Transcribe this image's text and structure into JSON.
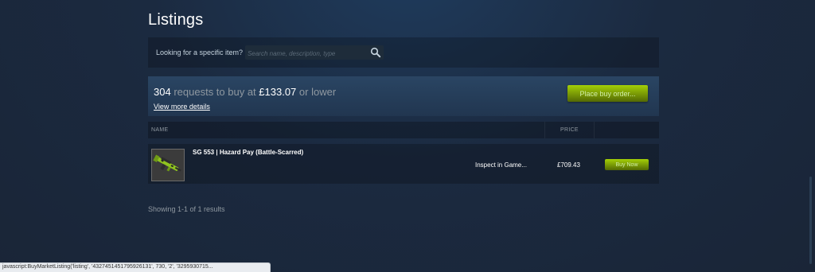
{
  "page": {
    "title": "Listings"
  },
  "search": {
    "label": "Looking for a specific item?",
    "placeholder": "Search name, description, type",
    "value": ""
  },
  "buy_order": {
    "count": "304",
    "text_requests": "requests to buy at",
    "price": "£133.07",
    "text_suffix": "or lower",
    "details_link": "View more details",
    "button_label": "Place buy order..."
  },
  "table": {
    "columns": [
      "NAME",
      "PRICE"
    ],
    "rows": [
      {
        "name": "SG 553 | Hazard Pay (Battle-Scarred)",
        "inspect_label": "Inspect in Game...",
        "price": "£709.43",
        "buy_label": "Buy Now"
      }
    ]
  },
  "results_text": "Showing 1-1 of 1 results",
  "status_bar": "javascript:BuyMarketListing('listing', '4327451451795926131', 730, '2', '3295930715...",
  "colors": {
    "accent_green": "#a4d007",
    "background": "#1b2a40",
    "muted_text": "#8f98a0"
  },
  "icons": {
    "search": "search-icon",
    "item": "rifle-icon"
  }
}
